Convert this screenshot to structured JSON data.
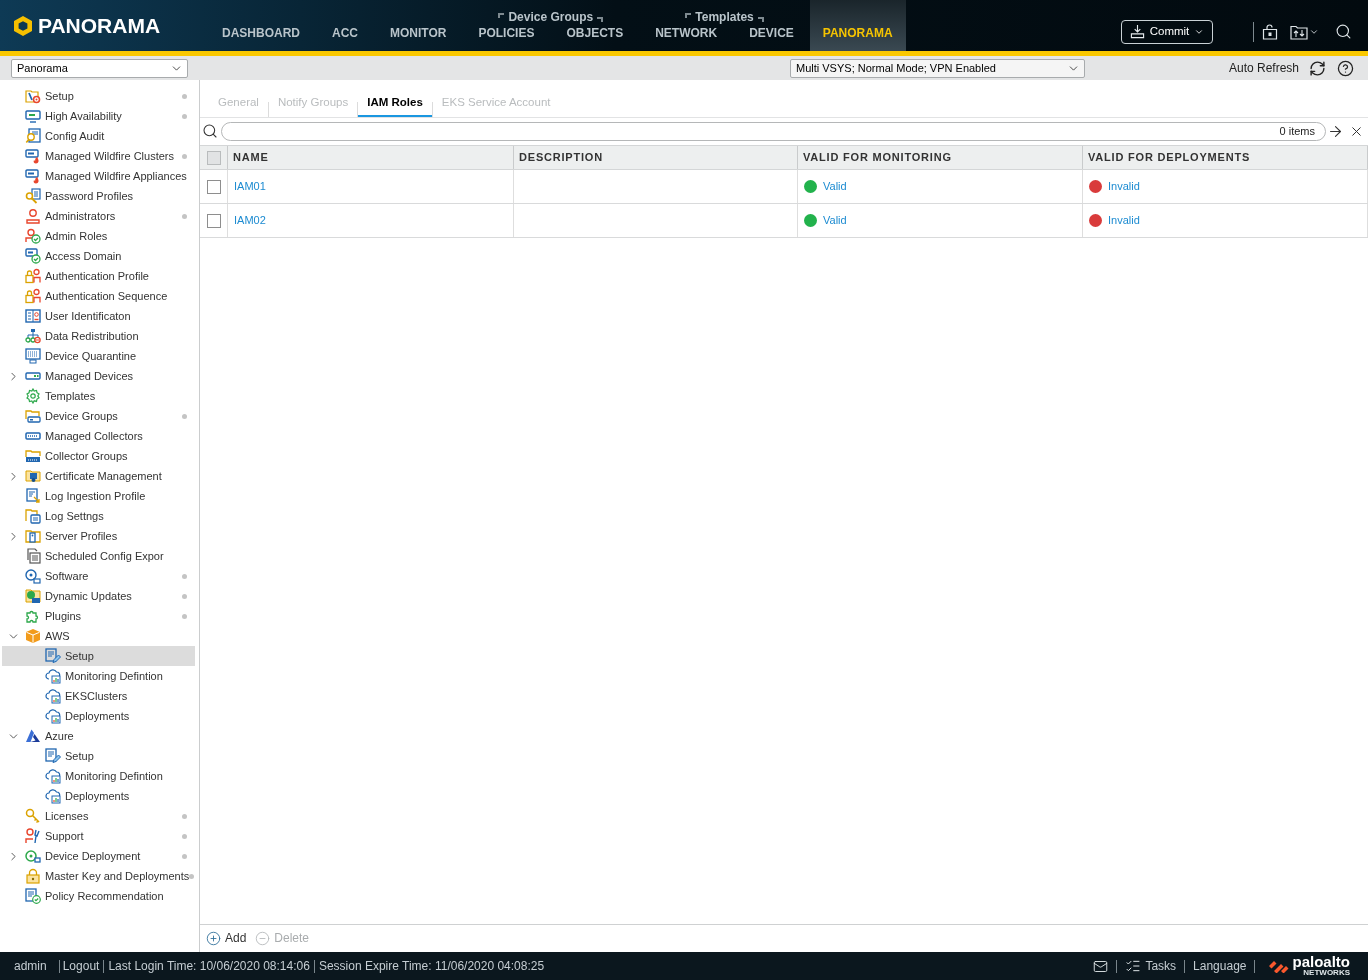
{
  "header": {
    "logo": "PANORAMA",
    "nav": [
      {
        "kind": "item",
        "label": "DASHBOARD",
        "selected": false
      },
      {
        "kind": "item",
        "label": "ACC",
        "selected": false
      },
      {
        "kind": "item",
        "label": "MONITOR",
        "selected": false
      },
      {
        "kind": "group",
        "label": "Device Groups",
        "items": [
          {
            "label": "POLICIES",
            "selected": false
          },
          {
            "label": "OBJECTS",
            "selected": false
          }
        ]
      },
      {
        "kind": "group",
        "label": "Templates",
        "items": [
          {
            "label": "NETWORK",
            "selected": false
          },
          {
            "label": "DEVICE",
            "selected": false
          }
        ]
      },
      {
        "kind": "item",
        "label": "PANORAMA",
        "selected": true
      }
    ],
    "commit_button": "Commit"
  },
  "context_bar": {
    "location_select": "Panorama",
    "mode_select": "Multi VSYS; Normal Mode; VPN Enabled",
    "auto_refresh": "Auto Refresh"
  },
  "sidebar": {
    "items": [
      {
        "label": "Setup",
        "dot": true,
        "selected": false
      },
      {
        "label": "High Availability",
        "dot": true,
        "selected": false
      },
      {
        "label": "Config Audit",
        "dot": false,
        "selected": false
      },
      {
        "label": "Managed Wildfire Clusters",
        "dot": true,
        "selected": false
      },
      {
        "label": "Managed Wildfire Appliances",
        "dot": false,
        "selected": false
      },
      {
        "label": "Password Profiles",
        "dot": false,
        "selected": false
      },
      {
        "label": "Administrators",
        "dot": true,
        "selected": false
      },
      {
        "label": "Admin Roles",
        "dot": false,
        "selected": false
      },
      {
        "label": "Access Domain",
        "dot": false,
        "selected": false
      },
      {
        "label": "Authentication Profile",
        "dot": false,
        "selected": false
      },
      {
        "label": "Authentication Sequence",
        "dot": false,
        "selected": false
      },
      {
        "label": "User Identificaton",
        "dot": false,
        "selected": false
      },
      {
        "label": "Data Redistribution",
        "dot": false,
        "selected": false
      },
      {
        "label": "Device Quarantine",
        "dot": false,
        "selected": false
      },
      {
        "label": "Managed Devices",
        "dot": false,
        "selected": false,
        "expanded": false
      },
      {
        "label": "Templates",
        "dot": false,
        "selected": false
      },
      {
        "label": "Device Groups",
        "dot": true,
        "selected": false
      },
      {
        "label": "Managed Collectors",
        "dot": false,
        "selected": false
      },
      {
        "label": "Collector Groups",
        "dot": false,
        "selected": false
      },
      {
        "label": "Certificate Management",
        "dot": false,
        "selected": false,
        "expanded": false
      },
      {
        "label": "Log Ingestion Profile",
        "dot": false,
        "selected": false
      },
      {
        "label": "Log Settngs",
        "dot": false,
        "selected": false
      },
      {
        "label": "Server Profiles",
        "dot": false,
        "selected": false,
        "expanded": false
      },
      {
        "label": "Scheduled Config Expor",
        "dot": false,
        "selected": false
      },
      {
        "label": "Software",
        "dot": true,
        "selected": false
      },
      {
        "label": "Dynamic Updates",
        "dot": true,
        "selected": false
      },
      {
        "label": "Plugins",
        "dot": true,
        "selected": false
      },
      {
        "label": "AWS",
        "dot": false,
        "selected": false,
        "expanded": true,
        "children": [
          {
            "label": "Setup",
            "dot": false,
            "selected": true
          },
          {
            "label": "Monitoring Defintion",
            "dot": false,
            "selected": false
          },
          {
            "label": "EKSClusters",
            "dot": false,
            "selected": false
          },
          {
            "label": "Deployments",
            "dot": false,
            "selected": false
          }
        ]
      },
      {
        "label": "Azure",
        "dot": false,
        "selected": false,
        "expanded": true,
        "children": [
          {
            "label": "Setup",
            "dot": false,
            "selected": false
          },
          {
            "label": "Monitoring Defintion",
            "dot": false,
            "selected": false
          },
          {
            "label": "Deployments",
            "dot": false,
            "selected": false
          }
        ]
      },
      {
        "label": "Licenses",
        "dot": true,
        "selected": false
      },
      {
        "label": "Support",
        "dot": true,
        "selected": false
      },
      {
        "label": "Device Deployment",
        "dot": true,
        "selected": false,
        "expanded": false
      },
      {
        "label": "Master Key and Deployments",
        "dot": true,
        "selected": false
      },
      {
        "label": "Policy Recommendation",
        "dot": false,
        "selected": false
      }
    ]
  },
  "tabs": [
    {
      "label": "General",
      "selected": false
    },
    {
      "label": "Notify Groups",
      "selected": false
    },
    {
      "label": "IAM Roles",
      "selected": true
    },
    {
      "label": "EKS Service Account",
      "selected": false
    }
  ],
  "search": {
    "count": "0 items"
  },
  "table": {
    "header_checked": false,
    "columns": [
      "NAME",
      "DESCRIPTION",
      "VALID FOR MONITORING",
      "VALID FOR DEPLOYMENTS"
    ],
    "rows": [
      {
        "checked": false,
        "name": "IAM01",
        "monitoring": {
          "text": "Valid",
          "color": "#22b24c"
        },
        "deployments": {
          "text": "Invalid",
          "color": "#d93b3b"
        }
      },
      {
        "checked": false,
        "name": "IAM02",
        "monitoring": {
          "text": "Valid",
          "color": "#22b24c"
        },
        "deployments": {
          "text": "Invalid",
          "color": "#d93b3b"
        }
      }
    ]
  },
  "actions": [
    {
      "kind": "add",
      "label": "Add",
      "disabled": false
    },
    {
      "kind": "delete",
      "label": "Delete",
      "disabled": true
    }
  ],
  "status_bar": {
    "user": "admin",
    "logout": "Logout",
    "last_login": "Last Login Time: 10/06/2020 08:14:06",
    "session_expire": "Session Expire Time: 11/06/2020 04:08:25",
    "tasks": "Tasks",
    "language": "Language",
    "brand": "paloalto",
    "brand_sub": "NETWORKS"
  }
}
